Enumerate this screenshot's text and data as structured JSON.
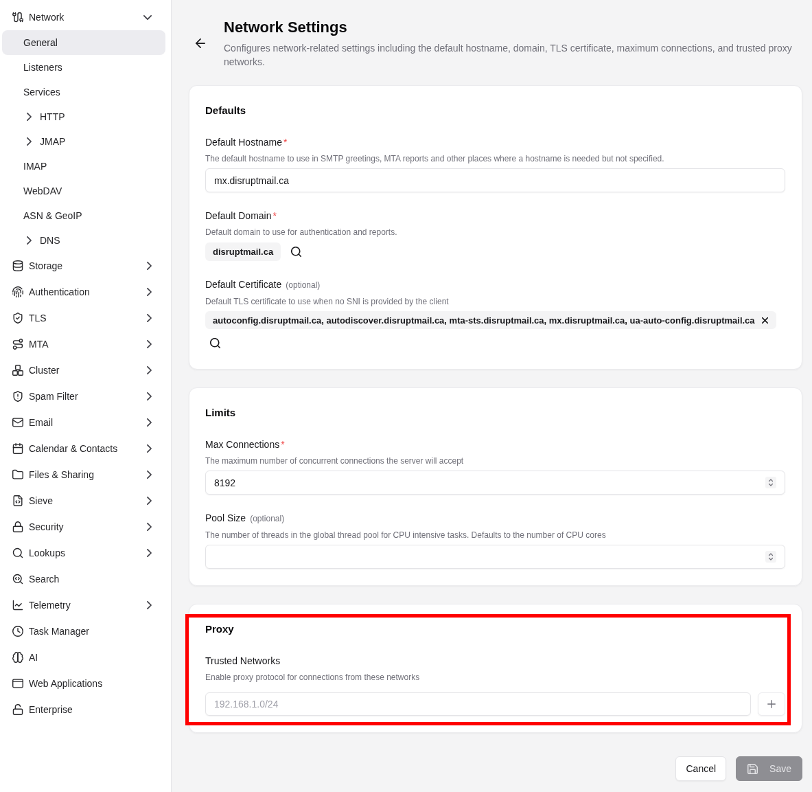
{
  "sidebar": {
    "items": [
      {
        "label": "Network",
        "kind": "group",
        "expanded": true,
        "selected": false,
        "children": [
          {
            "label": "General",
            "kind": "link",
            "selected": true
          },
          {
            "label": "Listeners",
            "kind": "link",
            "selected": false
          },
          {
            "label": "Services",
            "kind": "link",
            "selected": false
          },
          {
            "label": "HTTP",
            "kind": "group",
            "expanded": false,
            "selected": false
          },
          {
            "label": "JMAP",
            "kind": "group",
            "expanded": false,
            "selected": false
          },
          {
            "label": "IMAP",
            "kind": "link",
            "selected": false
          },
          {
            "label": "WebDAV",
            "kind": "link",
            "selected": false
          },
          {
            "label": "ASN & GeoIP",
            "kind": "link",
            "selected": false
          },
          {
            "label": "DNS",
            "kind": "group",
            "expanded": false,
            "selected": false
          }
        ]
      },
      {
        "label": "Storage",
        "kind": "group",
        "expanded": false,
        "selected": false
      },
      {
        "label": "Authentication",
        "kind": "group",
        "expanded": false,
        "selected": false
      },
      {
        "label": "TLS",
        "kind": "group",
        "expanded": false,
        "selected": false
      },
      {
        "label": "MTA",
        "kind": "group",
        "expanded": false,
        "selected": false
      },
      {
        "label": "Cluster",
        "kind": "group",
        "expanded": false,
        "selected": false
      },
      {
        "label": "Spam Filter",
        "kind": "group",
        "expanded": false,
        "selected": false
      },
      {
        "label": "Email",
        "kind": "group",
        "expanded": false,
        "selected": false
      },
      {
        "label": "Calendar & Contacts",
        "kind": "group",
        "expanded": false,
        "selected": false
      },
      {
        "label": "Files & Sharing",
        "kind": "group",
        "expanded": false,
        "selected": false
      },
      {
        "label": "Sieve",
        "kind": "group",
        "expanded": false,
        "selected": false
      },
      {
        "label": "Security",
        "kind": "group",
        "expanded": false,
        "selected": false
      },
      {
        "label": "Lookups",
        "kind": "group",
        "expanded": false,
        "selected": false
      },
      {
        "label": "Search",
        "kind": "link",
        "selected": false
      },
      {
        "label": "Telemetry",
        "kind": "group",
        "expanded": false,
        "selected": false
      },
      {
        "label": "Task Manager",
        "kind": "link",
        "selected": false
      },
      {
        "label": "AI",
        "kind": "link",
        "selected": false
      },
      {
        "label": "Web Applications",
        "kind": "link",
        "selected": false
      },
      {
        "label": "Enterprise",
        "kind": "link",
        "selected": false
      }
    ]
  },
  "header": {
    "title": "Network Settings",
    "description": "Configures network-related settings including the default hostname, domain, TLS certificate, maximum connections, and trusted proxy networks."
  },
  "sections": [
    {
      "title": "Defaults",
      "highlighted": false,
      "fields": [
        {
          "kind": "text",
          "label": "Default Hostname",
          "marker": "*",
          "help": "The default hostname to use in SMTP greetings, MTA reports and other places where a hostname is needed but not specified.",
          "value": "mx.disruptmail.ca"
        },
        {
          "kind": "lookup",
          "label": "Default Domain",
          "marker": "*",
          "help": "Default domain to use for authentication and reports.",
          "chips": [
            {
              "text": "disruptmail.ca",
              "removable": false
            }
          ]
        },
        {
          "kind": "lookup",
          "label": "Default Certificate",
          "note": "(optional)",
          "help": "Default TLS certificate to use when no SNI is provided by the client",
          "chips": [
            {
              "text": "autoconfig.disruptmail.ca, autodiscover.disruptmail.ca, mta-sts.disruptmail.ca, mx.disruptmail.ca, ua-auto-config.disruptmail.ca",
              "removable": true
            }
          ]
        }
      ]
    },
    {
      "title": "Limits",
      "highlighted": false,
      "fields": [
        {
          "kind": "number",
          "label": "Max Connections",
          "marker": "*",
          "help": "The maximum number of concurrent connections the server will accept",
          "value": "8192"
        },
        {
          "kind": "number",
          "label": "Pool Size",
          "note": "(optional)",
          "help": "The number of threads in the global thread pool for CPU intensive tasks. Defaults to the number of CPU cores"
        }
      ]
    },
    {
      "title": "Proxy",
      "highlighted": true,
      "fields": [
        {
          "kind": "list",
          "label": "Trusted Networks",
          "help": "Enable proxy protocol for connections from these networks",
          "placeholder": "192.168.1.0/24"
        }
      ]
    }
  ],
  "footer": {
    "buttons": [
      {
        "label": "Cancel",
        "kind": "secondary",
        "disabled": false
      },
      {
        "label": "Save",
        "kind": "primary",
        "disabled": true
      }
    ]
  }
}
